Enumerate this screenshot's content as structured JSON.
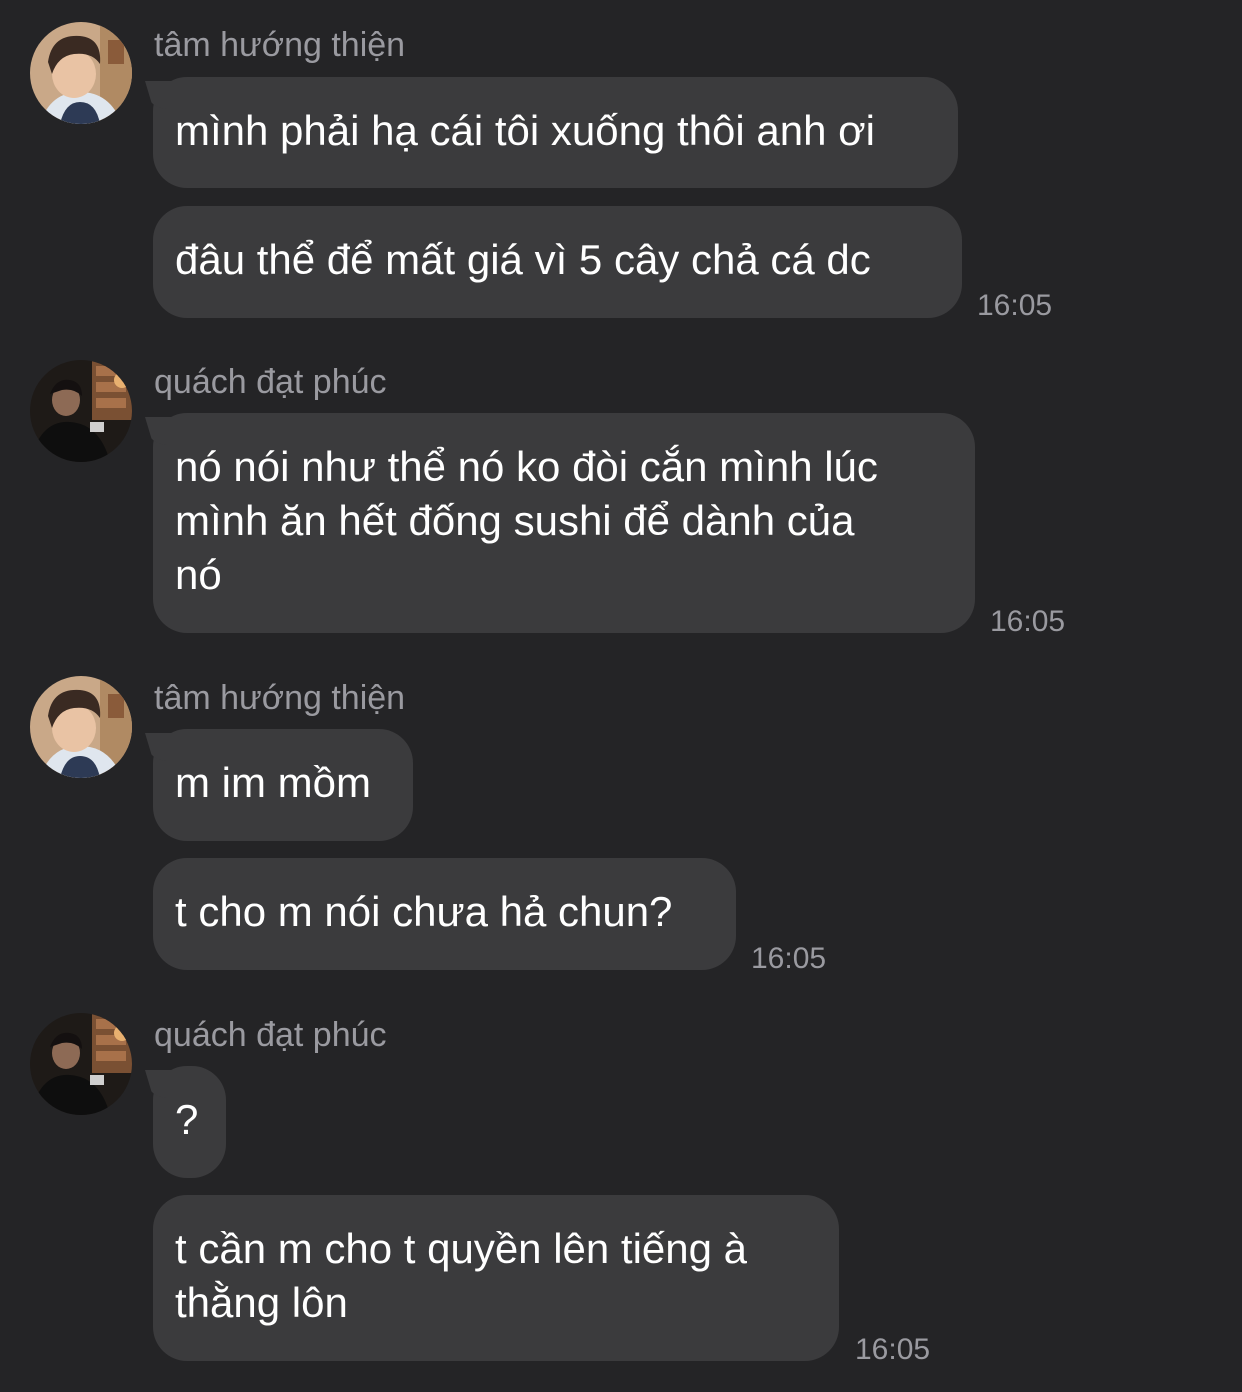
{
  "messages": [
    {
      "sender": "tâm hướng thiện",
      "avatar": "avatar-tam-huong-thien",
      "bubbles": [
        "mình phải hạ cái tôi xuống thôi anh ơi",
        "đâu thể để mất giá vì 5 cây chả cá dc"
      ],
      "time": "16:05"
    },
    {
      "sender": "quách đạt phúc",
      "avatar": "avatar-quach-dat-phuc",
      "bubbles": [
        [
          "nó nói như thể nó ko đòi cắn mình lúc",
          "mình ăn hết đống sushi để dành của",
          "nó"
        ]
      ],
      "time": "16:05"
    },
    {
      "sender": "tâm hướng thiện",
      "avatar": "avatar-tam-huong-thien",
      "bubbles": [
        "m im mồm",
        "t cho m nói chưa hả chun?"
      ],
      "time": "16:05"
    },
    {
      "sender": "quách đạt phúc",
      "avatar": "avatar-quach-dat-phuc",
      "bubbles": [
        "?",
        [
          "t cần m cho t quyền lên tiếng à",
          "thằng lôn"
        ]
      ],
      "time": "16:05"
    }
  ],
  "colors": {
    "background": "#242426",
    "bubble": "#3b3b3d",
    "secondary_text": "#9a9aa0",
    "text": "#ffffff"
  }
}
